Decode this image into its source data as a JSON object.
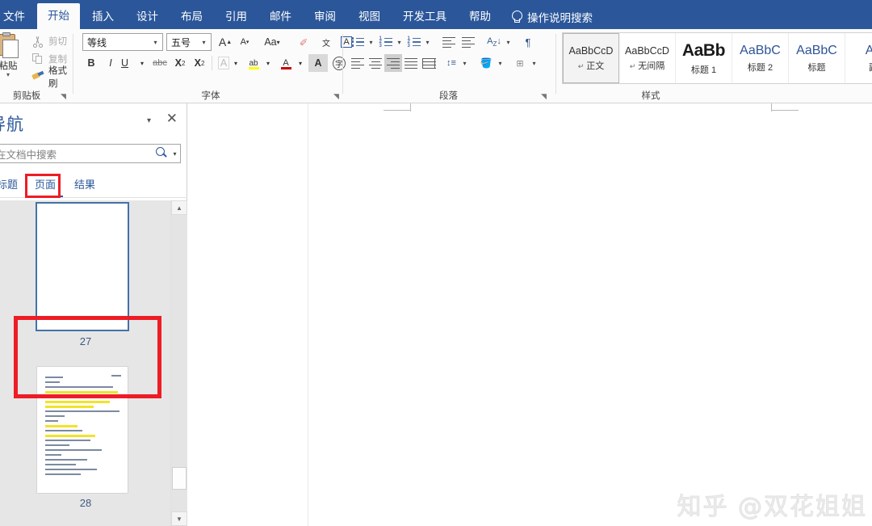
{
  "app": {
    "accent_color": "#2b579a",
    "annotation_color": "#ee1c25",
    "ribbon_bg": "#fbfbfb"
  },
  "ribbon_tabs": [
    {
      "label": "文件",
      "active": false
    },
    {
      "label": "开始",
      "active": true
    },
    {
      "label": "插入",
      "active": false
    },
    {
      "label": "设计",
      "active": false
    },
    {
      "label": "布局",
      "active": false
    },
    {
      "label": "引用",
      "active": false
    },
    {
      "label": "邮件",
      "active": false
    },
    {
      "label": "审阅",
      "active": false
    },
    {
      "label": "视图",
      "active": false
    },
    {
      "label": "开发工具",
      "active": false
    },
    {
      "label": "帮助",
      "active": false
    }
  ],
  "tell_me": {
    "icon": "lightbulb-icon",
    "label": "操作说明搜索"
  },
  "groups": {
    "clipboard": {
      "label": "剪贴板",
      "paste": {
        "label": "粘贴",
        "icon": "clipboard-paste-icon",
        "caret": "▾"
      },
      "items": [
        {
          "label": "剪切",
          "icon": "scissors-icon"
        },
        {
          "label": "复制",
          "icon": "copy-icon"
        },
        {
          "label": "格式刷",
          "icon": "format-painter-icon"
        }
      ],
      "launcher": "◥"
    },
    "font": {
      "label": "字体",
      "font_name": "等线",
      "font_size": "五号",
      "buttons_row1": [
        {
          "name": "grow-font",
          "glyph": "A"
        },
        {
          "name": "shrink-font",
          "glyph": "A"
        },
        {
          "name": "change-case",
          "glyph": "Aa"
        },
        {
          "name": "clear-formatting",
          "glyph": "✐"
        },
        {
          "name": "phonetic-guide",
          "glyph": "文"
        },
        {
          "name": "character-border",
          "glyph": "A"
        }
      ],
      "buttons_row2": [
        {
          "name": "bold",
          "glyph": "B"
        },
        {
          "name": "italic",
          "glyph": "I"
        },
        {
          "name": "underline",
          "glyph": "U"
        },
        {
          "name": "strikethrough",
          "glyph": "abc"
        },
        {
          "name": "subscript",
          "glyph": "X"
        },
        {
          "name": "superscript",
          "glyph": "X"
        },
        {
          "name": "text-effects",
          "glyph": "A"
        },
        {
          "name": "text-highlight",
          "glyph": "ab"
        },
        {
          "name": "font-color",
          "glyph": "A"
        },
        {
          "name": "character-shading",
          "glyph": "A"
        },
        {
          "name": "enclose-characters",
          "glyph": "字"
        }
      ],
      "launcher": "◥"
    },
    "paragraph": {
      "label": "段落",
      "launcher": "◥",
      "buttons": [
        {
          "name": "bullets"
        },
        {
          "name": "numbering"
        },
        {
          "name": "multilevel-list"
        },
        {
          "name": "decrease-indent"
        },
        {
          "name": "increase-indent"
        },
        {
          "name": "sort"
        },
        {
          "name": "show-formatting-marks"
        },
        {
          "name": "align-left"
        },
        {
          "name": "align-center"
        },
        {
          "name": "align-right"
        },
        {
          "name": "justify"
        },
        {
          "name": "distribute"
        },
        {
          "name": "line-spacing"
        },
        {
          "name": "shading"
        },
        {
          "name": "borders"
        }
      ],
      "active_alignment": "align-right"
    },
    "styles": {
      "label": "样式",
      "items": [
        {
          "preview": "AaBbCcD",
          "name": "正文",
          "pilcrow": "↵",
          "selected": true,
          "size": "normal"
        },
        {
          "preview": "AaBbCcD",
          "name": "无间隔",
          "pilcrow": "↵",
          "selected": false,
          "size": "normal"
        },
        {
          "preview": "AaBb",
          "name": "标题 1",
          "pilcrow": "",
          "selected": false,
          "size": "big"
        },
        {
          "preview": "AaBbC",
          "name": "标题 2",
          "pilcrow": "",
          "selected": false,
          "size": "h2"
        },
        {
          "preview": "AaBbC",
          "name": "标题",
          "pilcrow": "",
          "selected": false,
          "size": "h3"
        },
        {
          "preview": "Aa",
          "name": "副",
          "pilcrow": "",
          "selected": false,
          "size": "h4"
        }
      ]
    }
  },
  "navigation": {
    "title": "导航",
    "collapse_caret": "▾",
    "close_glyph": "✕",
    "search": {
      "placeholder": "在文档中搜索",
      "value": "",
      "icon": "search-icon",
      "dropdown_caret": "▾"
    },
    "tabs": [
      {
        "label": "标题",
        "selected": false
      },
      {
        "label": "页面",
        "selected": true
      },
      {
        "label": "结果",
        "selected": false
      }
    ],
    "pages": [
      {
        "number": "27",
        "selected": true,
        "blank": true
      },
      {
        "number": "28",
        "selected": false,
        "blank": false
      }
    ],
    "scrollbar": {
      "up_glyph": "▲",
      "down_glyph": "▼"
    }
  },
  "annotations": [
    {
      "name": "page-thumbnail-highlight-box"
    },
    {
      "name": "pages-tab-highlight-box"
    }
  ],
  "watermark": {
    "text": "知乎 @双花姐姐"
  }
}
